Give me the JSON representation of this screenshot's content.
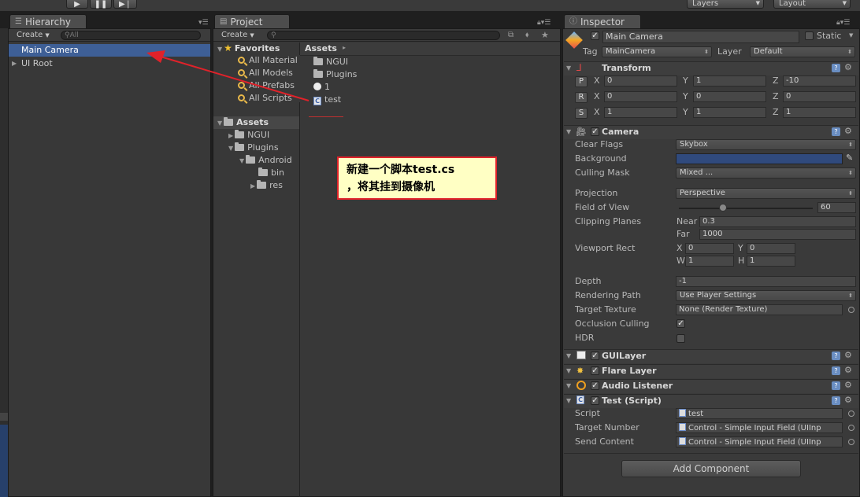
{
  "toolbar": {
    "play_icon": "play-icon",
    "pause_icon": "pause-icon",
    "step_icon": "step-icon",
    "layers_label": "Layers",
    "layout_label": "Layout"
  },
  "hierarchy": {
    "tab_label": "Hierarchy",
    "create_label": "Create",
    "search_placeholder": "All",
    "items": [
      {
        "label": "Main Camera",
        "selected": true
      },
      {
        "label": "UI Root",
        "selected": false
      }
    ]
  },
  "project": {
    "tab_label": "Project",
    "create_label": "Create",
    "favorites_label": "Favorites",
    "favorites": [
      "All Material",
      "All Models",
      "All Prefabs",
      "All Scripts"
    ],
    "assets_label": "Assets",
    "tree": [
      "NGUI",
      "Plugins",
      "Android",
      "bin",
      "res"
    ],
    "breadcrumb": "Assets",
    "files": [
      {
        "label": "NGUI",
        "icon": "folder-icon"
      },
      {
        "label": "Plugins",
        "icon": "folder-icon"
      },
      {
        "label": "1",
        "icon": "unity-scene-icon"
      },
      {
        "label": "test",
        "icon": "script-icon"
      }
    ]
  },
  "inspector": {
    "tab_label": "Inspector",
    "object_name": "Main Camera",
    "static_label": "Static",
    "tag_label": "Tag",
    "tag_value": "MainCamera",
    "layer_label": "Layer",
    "layer_value": "Default",
    "transform": {
      "title": "Transform",
      "rows": [
        {
          "btn": "P",
          "x": "0",
          "y": "1",
          "z": "-10"
        },
        {
          "btn": "R",
          "x": "0",
          "y": "0",
          "z": "0"
        },
        {
          "btn": "S",
          "x": "1",
          "y": "1",
          "z": "1"
        }
      ]
    },
    "camera": {
      "title": "Camera",
      "clear_flags_label": "Clear Flags",
      "clear_flags_value": "Skybox",
      "background_label": "Background",
      "background_color": "#304a7d",
      "culling_mask_label": "Culling Mask",
      "culling_mask_value": "Mixed ...",
      "projection_label": "Projection",
      "projection_value": "Perspective",
      "fov_label": "Field of View",
      "fov_value": "60",
      "fov_fraction": 0.33,
      "clipping_label": "Clipping Planes",
      "near_label": "Near",
      "near_value": "0.3",
      "far_label": "Far",
      "far_value": "1000",
      "viewport_label": "Viewport Rect",
      "vx": "0",
      "vy": "0",
      "vw": "1",
      "vh": "1",
      "depth_label": "Depth",
      "depth_value": "-1",
      "rendering_label": "Rendering Path",
      "rendering_value": "Use Player Settings",
      "target_texture_label": "Target Texture",
      "target_texture_value": "None (Render Texture)",
      "occlusion_label": "Occlusion Culling",
      "hdr_label": "HDR"
    },
    "guilayer_title": "GUILayer",
    "flare_title": "Flare Layer",
    "audio_title": "Audio Listener",
    "test_script": {
      "title": "Test (Script)",
      "script_label": "Script",
      "script_value": "test",
      "target_number_label": "Target Number",
      "target_number_value": "Control - Simple Input Field (UIInp",
      "send_content_label": "Send Content",
      "send_content_value": "Control - Simple Input Field (UIInp"
    },
    "add_component_label": "Add Component"
  },
  "annotation": {
    "line1": "新建一个脚本test.cs",
    "line2": "，将其挂到摄像机",
    "color": "#e0222a"
  }
}
